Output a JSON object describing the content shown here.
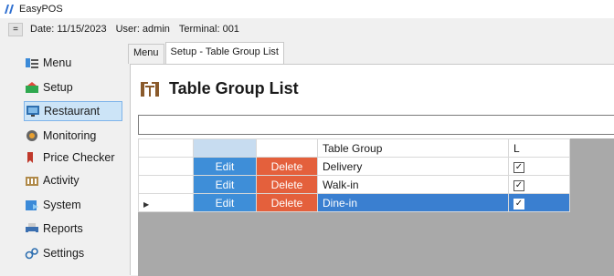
{
  "app": {
    "title": "EasyPOS"
  },
  "infobar": {
    "menu_toggle": "=",
    "date": "Date: 11/15/2023",
    "user": "User: admin",
    "terminal": "Terminal: 001"
  },
  "sidebar": {
    "items": [
      {
        "label": "Menu",
        "icon": "menu-icon"
      },
      {
        "label": "Setup",
        "icon": "setup-icon"
      },
      {
        "label": "Restaurant",
        "icon": "restaurant-icon",
        "selected": true
      },
      {
        "label": "Monitoring",
        "icon": "monitoring-icon"
      },
      {
        "label": "Price Checker",
        "icon": "price-tag-icon"
      },
      {
        "label": "Activity",
        "icon": "activity-icon"
      },
      {
        "label": "System",
        "icon": "system-icon"
      },
      {
        "label": "Reports",
        "icon": "printer-icon"
      },
      {
        "label": "Settings",
        "icon": "settings-icon"
      }
    ]
  },
  "tabs": [
    {
      "label": "Menu"
    },
    {
      "label": "Setup - Table Group List",
      "active": true
    }
  ],
  "page": {
    "title": "Table Group List"
  },
  "search": {
    "value": ""
  },
  "grid": {
    "headers": [
      "",
      "",
      "",
      "Table Group",
      "L"
    ],
    "rows": [
      {
        "edit": "Edit",
        "delete": "Delete",
        "name": "Delivery",
        "locked": true,
        "selected": false
      },
      {
        "edit": "Edit",
        "delete": "Delete",
        "name": "Walk-in",
        "locked": true,
        "selected": false
      },
      {
        "edit": "Edit",
        "delete": "Delete",
        "name": "Dine-in",
        "locked": true,
        "selected": true
      }
    ]
  },
  "colors": {
    "edit_button": "#3e8ed8",
    "delete_button": "#e4603c",
    "selection": "#3a7fd0"
  }
}
